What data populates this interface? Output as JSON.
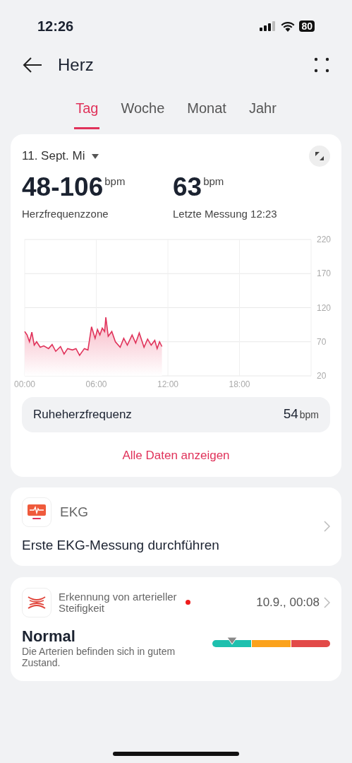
{
  "status_bar": {
    "time": "12:26",
    "battery": "80"
  },
  "header": {
    "title": "Herz"
  },
  "tabs": [
    {
      "label": "Tag",
      "selected": true
    },
    {
      "label": "Woche",
      "selected": false
    },
    {
      "label": "Monat",
      "selected": false
    },
    {
      "label": "Jahr",
      "selected": false
    }
  ],
  "heart_card": {
    "date": "11. Sept. Mi",
    "stats": [
      {
        "value": "48-106",
        "unit": "bpm",
        "label": "Herzfrequenzzone"
      },
      {
        "value": "63",
        "unit": "bpm",
        "label": "Letzte Messung 12:23"
      }
    ],
    "chart_data": {
      "type": "area",
      "x": [
        0,
        0.2,
        0.4,
        0.6,
        0.8,
        1.0,
        1.3,
        1.6,
        2.0,
        2.3,
        2.6,
        3.0,
        3.3,
        3.6,
        4.0,
        4.3,
        4.6,
        5.0,
        5.3,
        5.6,
        5.9,
        6.1,
        6.3,
        6.5,
        6.7,
        6.8,
        7.0,
        7.3,
        7.6,
        8.0,
        8.3,
        8.6,
        9.0,
        9.3,
        9.6,
        10.0,
        10.3,
        10.6,
        10.9,
        11.1,
        11.3,
        11.5
      ],
      "series": [
        {
          "color": "#e0325a",
          "values": [
            85,
            80,
            70,
            84,
            65,
            70,
            62,
            64,
            60,
            66,
            56,
            63,
            52,
            60,
            58,
            60,
            50,
            60,
            58,
            92,
            75,
            88,
            80,
            90,
            85,
            106,
            78,
            85,
            70,
            62,
            75,
            65,
            80,
            68,
            83,
            62,
            74,
            65,
            72,
            60,
            70,
            63
          ]
        }
      ],
      "xlim": [
        0,
        24
      ],
      "ylim": [
        20,
        220
      ],
      "xticks": [
        {
          "value": 0,
          "label": "00:00"
        },
        {
          "value": 6,
          "label": "06:00"
        },
        {
          "value": 12,
          "label": "12:00"
        },
        {
          "value": 18,
          "label": "18:00"
        }
      ],
      "yticks": [
        20,
        70,
        120,
        170,
        220
      ],
      "grid": true
    },
    "resting": {
      "label": "Ruheherzfrequenz",
      "value": "54",
      "unit": "bpm"
    },
    "link": "Alle Daten anzeigen"
  },
  "ekg_card": {
    "title": "EKG",
    "action": "Erste EKG-Messung durchführen"
  },
  "stiffness_card": {
    "title": "Erkennung von arterieller Steifigkeit",
    "new": true,
    "time": "10.9., 00:08",
    "result": "Normal",
    "description": "Die Arterien befinden sich in gutem Zustand."
  }
}
